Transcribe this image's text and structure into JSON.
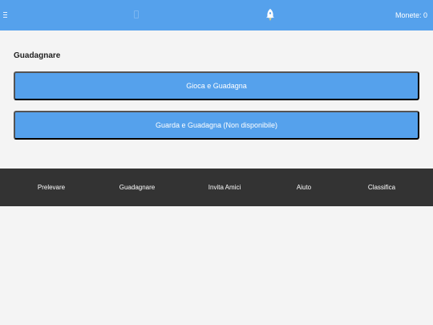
{
  "topbar": {
    "coins_label": "Monete: 0",
    "icons": {
      "menu": "hamburger-menu-icon",
      "center": "placeholder-icon",
      "brand": "rocket-icon"
    }
  },
  "main": {
    "section_title": "Guadagnare",
    "buttons": [
      {
        "label": "Gioca e Guadagna"
      },
      {
        "label": "Guarda e Guadagna (Non disponibile)"
      }
    ]
  },
  "footer": {
    "items": [
      {
        "label": "Prelevare"
      },
      {
        "label": "Guadagnare"
      },
      {
        "label": "Invita Amici"
      },
      {
        "label": "Aiuto"
      },
      {
        "label": "Classifica"
      }
    ]
  },
  "colors": {
    "primary": "#55a1ec",
    "footer_bg": "#333333",
    "page_bg": "#f4f4f4"
  }
}
